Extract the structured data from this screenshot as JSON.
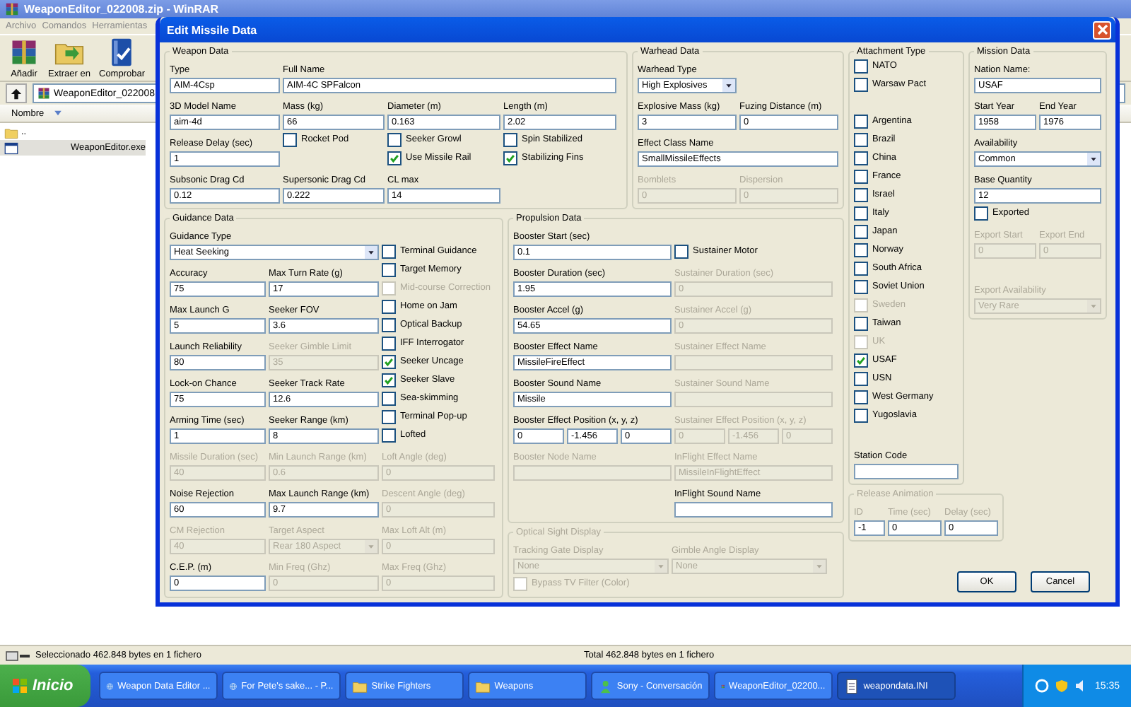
{
  "app_window": {
    "title": "WeaponEditor_022008.zip - WinRAR"
  },
  "menu": [
    "Archivo",
    "Comandos",
    "Herramientas"
  ],
  "toolbar": [
    {
      "label": "Añadir"
    },
    {
      "label": "Extraer en"
    },
    {
      "label": "Comprobar"
    }
  ],
  "path": "WeaponEditor_022008",
  "list": {
    "columns": [
      "Nombre"
    ],
    "rows": [
      {
        "name": "..",
        "selected": false
      },
      {
        "name": "WeaponEditor.exe",
        "selected": true
      }
    ]
  },
  "status_bar": [
    "Seleccionado 462.848 bytes en 1 fichero",
    "Total 462.848 bytes en 1 fichero"
  ],
  "dialog": {
    "title": "Edit Missile Data",
    "groups": [
      {
        "title": "Weapon Data",
        "disabled": false,
        "items": [
          {
            "kind": "field",
            "label": "Type",
            "value": "AIM-4Csp",
            "disabled": false
          },
          {
            "kind": "field",
            "label": "Full Name",
            "value": "AIM-4C SPFalcon",
            "disabled": false
          },
          {
            "kind": "field",
            "label": "3D Model Name",
            "value": "aim-4d",
            "disabled": false
          },
          {
            "kind": "field",
            "label": "Mass (kg)",
            "value": "66",
            "disabled": false
          },
          {
            "kind": "field",
            "label": "Diameter (m)",
            "value": "0.163",
            "disabled": false
          },
          {
            "kind": "field",
            "label": "Length (m)",
            "value": "2.02",
            "disabled": false
          },
          {
            "kind": "field",
            "label": "Release Delay (sec)",
            "value": "1",
            "disabled": false
          },
          {
            "kind": "check",
            "label": "Rocket Pod",
            "checked": false,
            "disabled": false
          },
          {
            "kind": "check",
            "label": "Seeker Growl",
            "checked": false,
            "disabled": false
          },
          {
            "kind": "check",
            "label": "Spin Stabilized",
            "checked": false,
            "disabled": false
          },
          {
            "kind": "check",
            "label": "Use Missile Rail",
            "checked": true,
            "disabled": false
          },
          {
            "kind": "check",
            "label": "Stabilizing Fins",
            "checked": true,
            "disabled": false
          },
          {
            "kind": "field",
            "label": "Subsonic Drag Cd",
            "value": "0.12",
            "disabled": false
          },
          {
            "kind": "field",
            "label": "Supersonic Drag Cd",
            "value": "0.222",
            "disabled": false
          },
          {
            "kind": "field",
            "label": "CL max",
            "value": "14",
            "disabled": false
          }
        ]
      },
      {
        "title": "Warhead Data",
        "disabled": false,
        "items": [
          {
            "kind": "select",
            "label": "Warhead Type",
            "value": "High Explosives",
            "disabled": false
          },
          {
            "kind": "field",
            "label": "Explosive Mass (kg)",
            "value": "3",
            "disabled": false
          },
          {
            "kind": "field",
            "label": "Fuzing Distance (m)",
            "value": "0",
            "disabled": false
          },
          {
            "kind": "field",
            "label": "Effect Class Name",
            "value": "SmallMissileEffects",
            "disabled": false
          },
          {
            "kind": "field",
            "label": "Bomblets",
            "value": "0",
            "disabled": true
          },
          {
            "kind": "field",
            "label": "Dispersion",
            "value": "0",
            "disabled": true
          }
        ]
      },
      {
        "title": "Attachment Type",
        "disabled": false,
        "items": [
          {
            "kind": "check",
            "label": "NATO",
            "checked": false,
            "disabled": false
          },
          {
            "kind": "check",
            "label": "Warsaw Pact",
            "checked": false,
            "disabled": false
          },
          {
            "kind": "check",
            "label": "Argentina",
            "checked": false,
            "disabled": false
          },
          {
            "kind": "check",
            "label": "Brazil",
            "checked": false,
            "disabled": false
          },
          {
            "kind": "check",
            "label": "China",
            "checked": false,
            "disabled": false
          },
          {
            "kind": "check",
            "label": "France",
            "checked": false,
            "disabled": false
          },
          {
            "kind": "check",
            "label": "Israel",
            "checked": false,
            "disabled": false
          },
          {
            "kind": "check",
            "label": "Italy",
            "checked": false,
            "disabled": false
          },
          {
            "kind": "check",
            "label": "Japan",
            "checked": false,
            "disabled": false
          },
          {
            "kind": "check",
            "label": "Norway",
            "checked": false,
            "disabled": false
          },
          {
            "kind": "check",
            "label": "South Africa",
            "checked": false,
            "disabled": false
          },
          {
            "kind": "check",
            "label": "Soviet Union",
            "checked": false,
            "disabled": false
          },
          {
            "kind": "check",
            "label": "Sweden",
            "checked": false,
            "disabled": true
          },
          {
            "kind": "check",
            "label": "Taiwan",
            "checked": false,
            "disabled": false
          },
          {
            "kind": "check",
            "label": "UK",
            "checked": false,
            "disabled": true
          },
          {
            "kind": "check",
            "label": "USAF",
            "checked": true,
            "disabled": false
          },
          {
            "kind": "check",
            "label": "USN",
            "checked": false,
            "disabled": false
          },
          {
            "kind": "check",
            "label": "West Germany",
            "checked": false,
            "disabled": false
          },
          {
            "kind": "check",
            "label": "Yugoslavia",
            "checked": false,
            "disabled": false
          },
          {
            "kind": "field",
            "label": "Station Code",
            "disabled": false
          }
        ]
      },
      {
        "title": "Mission Data",
        "disabled": false,
        "items": [
          {
            "kind": "field",
            "label": "Nation Name:",
            "value": "USAF",
            "disabled": false
          },
          {
            "kind": "field",
            "label": "Start Year",
            "value": "1958",
            "disabled": false
          },
          {
            "kind": "field",
            "label": "End Year",
            "value": "1976",
            "disabled": false
          },
          {
            "kind": "select",
            "label": "Availability",
            "value": "Common",
            "disabled": false
          },
          {
            "kind": "field",
            "label": "Base Quantity",
            "value": "12",
            "disabled": false
          },
          {
            "kind": "check",
            "label": "Exported",
            "checked": false,
            "disabled": false
          },
          {
            "kind": "field",
            "label": "Export Start",
            "value": "0",
            "disabled": true
          },
          {
            "kind": "field",
            "label": "Export End",
            "value": "0",
            "disabled": true
          },
          {
            "kind": "select",
            "label": "Export Availability",
            "value": "Very Rare",
            "disabled": true
          }
        ]
      },
      {
        "title": "Guidance Data",
        "disabled": false,
        "items": [
          {
            "kind": "select",
            "label": "Guidance Type",
            "value": "Heat Seeking",
            "disabled": false
          },
          {
            "kind": "field",
            "label": "Accuracy",
            "value": "75",
            "disabled": false
          },
          {
            "kind": "field",
            "label": "Max Turn Rate (g)",
            "value": "17",
            "disabled": false
          },
          {
            "kind": "field",
            "label": "Max Launch G",
            "value": "5",
            "disabled": false
          },
          {
            "kind": "field",
            "label": "Seeker FOV",
            "value": "3.6",
            "disabled": false
          },
          {
            "kind": "field",
            "label": "Launch Reliability",
            "value": "80",
            "disabled": false
          },
          {
            "kind": "field",
            "label": "Seeker Gimble Limit",
            "value": "35",
            "disabled": true
          },
          {
            "kind": "field",
            "label": "Lock-on Chance",
            "value": "75",
            "disabled": false
          },
          {
            "kind": "field",
            "label": "Seeker Track Rate",
            "value": "12.6",
            "disabled": false
          },
          {
            "kind": "field",
            "label": "Arming Time (sec)",
            "value": "1",
            "disabled": false
          },
          {
            "kind": "field",
            "label": "Seeker Range (km)",
            "value": "8",
            "disabled": false
          },
          {
            "kind": "check",
            "label": "Terminal Guidance",
            "checked": false,
            "disabled": false
          },
          {
            "kind": "check",
            "label": "Target Memory",
            "checked": false,
            "disabled": false
          },
          {
            "kind": "check",
            "label": "Mid-course Correction",
            "checked": false,
            "disabled": true
          },
          {
            "kind": "check",
            "label": "Home on Jam",
            "checked": false,
            "disabled": false
          },
          {
            "kind": "check",
            "label": "Optical Backup",
            "checked": false,
            "disabled": false
          },
          {
            "kind": "check",
            "label": "IFF Interrogator",
            "checked": false,
            "disabled": false
          },
          {
            "kind": "check",
            "label": "Seeker Uncage",
            "checked": true,
            "disabled": false
          },
          {
            "kind": "check",
            "label": "Seeker Slave",
            "checked": true,
            "disabled": false
          },
          {
            "kind": "check",
            "label": "Sea-skimming",
            "checked": false,
            "disabled": false
          },
          {
            "kind": "check",
            "label": "Terminal Pop-up",
            "checked": false,
            "disabled": false
          },
          {
            "kind": "check",
            "label": "Lofted",
            "checked": false,
            "disabled": false
          },
          {
            "kind": "field",
            "label": "Missile Duration (sec)",
            "value": "40",
            "disabled": true
          },
          {
            "kind": "field",
            "label": "Min Launch Range (km)",
            "value": "0.6",
            "disabled": true
          },
          {
            "kind": "field",
            "label": "Loft Angle (deg)",
            "value": "0",
            "disabled": true
          },
          {
            "kind": "field",
            "label": "Noise Rejection",
            "value": "60",
            "disabled": false
          },
          {
            "kind": "field",
            "label": "Max Launch Range (km)",
            "value": "9.7",
            "disabled": false
          },
          {
            "kind": "field",
            "label": "Descent Angle (deg)",
            "value": "0",
            "disabled": true
          },
          {
            "kind": "field",
            "label": "CM Rejection",
            "value": "40",
            "disabled": true
          },
          {
            "kind": "select",
            "label": "Target Aspect",
            "value": "Rear 180 Aspect",
            "disabled": true
          },
          {
            "kind": "field",
            "label": "Max Loft Alt (m)",
            "value": "0",
            "disabled": true
          },
          {
            "kind": "field",
            "label": "C.E.P. (m)",
            "value": "0",
            "disabled": false
          },
          {
            "kind": "field",
            "label": "Min Freq (Ghz)",
            "value": "0",
            "disabled": true
          },
          {
            "kind": "field",
            "label": "Max Freq (Ghz)",
            "value": "0",
            "disabled": true
          }
        ]
      },
      {
        "title": "Propulsion Data",
        "disabled": false,
        "items": [
          {
            "kind": "field",
            "label": "Booster Start (sec)",
            "value": "0.1",
            "disabled": false
          },
          {
            "kind": "check",
            "label": "Sustainer Motor",
            "checked": false,
            "disabled": false
          },
          {
            "kind": "field",
            "label": "Booster Duration (sec)",
            "value": "1.95",
            "disabled": false
          },
          {
            "kind": "field",
            "label": "Sustainer Duration (sec)",
            "value": "0",
            "disabled": true
          },
          {
            "kind": "field",
            "label": "Booster Accel (g)",
            "value": "54.65",
            "disabled": false
          },
          {
            "kind": "field",
            "label": "Sustainer Accel (g)",
            "value": "0",
            "disabled": true
          },
          {
            "kind": "field",
            "label": "Booster Effect Name",
            "value": "MissileFireEffect",
            "disabled": false
          },
          {
            "kind": "field",
            "label": "Sustainer Effect Name",
            "disabled": true
          },
          {
            "kind": "field",
            "label": "Booster Sound Name",
            "value": "Missile",
            "disabled": false
          },
          {
            "kind": "field",
            "label": "Sustainer Sound Name",
            "disabled": true
          },
          {
            "kind": "triple",
            "label": "Booster Effect Position (x, y, z)",
            "values": [
              "0",
              "-1.456",
              "0"
            ],
            "disabled": false
          },
          {
            "kind": "triple",
            "label": "Sustainer Effect Position (x, y, z)",
            "values": [
              "0",
              "-1.456",
              "0"
            ],
            "disabled": true
          },
          {
            "kind": "field",
            "label": "Booster Node Name",
            "disabled": true
          },
          {
            "kind": "field",
            "label": "InFlight Effect Name",
            "value": "MissileInFlightEffect",
            "disabled": true
          },
          {
            "kind": "field",
            "label": "InFlight Sound Name",
            "disabled": false
          }
        ]
      },
      {
        "title": "Release Animation",
        "disabled": true,
        "items": [
          {
            "kind": "field",
            "label": "ID",
            "value": "-1",
            "disabled": false
          },
          {
            "kind": "field",
            "label": "Time (sec)",
            "value": "0",
            "disabled": false
          },
          {
            "kind": "field",
            "label": "Delay (sec)",
            "value": "0",
            "disabled": false
          }
        ]
      },
      {
        "title": "Optical Sight Display",
        "disabled": true,
        "items": [
          {
            "kind": "select",
            "label": "Tracking Gate Display",
            "value": "None",
            "disabled": true
          },
          {
            "kind": "select",
            "label": "Gimble Angle Display",
            "value": "None",
            "disabled": true
          },
          {
            "kind": "check",
            "label": "Bypass TV Filter (Color)",
            "checked": false,
            "disabled": true
          }
        ]
      }
    ],
    "buttons": [
      "OK",
      "Cancel"
    ]
  },
  "taskbar": {
    "start": "Inicio",
    "tasks": [
      {
        "label": "Weapon Data Editor ...",
        "selected": false
      },
      {
        "label": "For Pete's sake... - P...",
        "selected": false
      },
      {
        "label": "Strike Fighters",
        "selected": false
      },
      {
        "label": "Weapons",
        "selected": false
      },
      {
        "label": "Sony - Conversación",
        "selected": false
      },
      {
        "label": "WeaponEditor_02200...",
        "selected": false
      },
      {
        "label": "weapondata.INI",
        "selected": true
      }
    ],
    "clock": "15:35"
  }
}
